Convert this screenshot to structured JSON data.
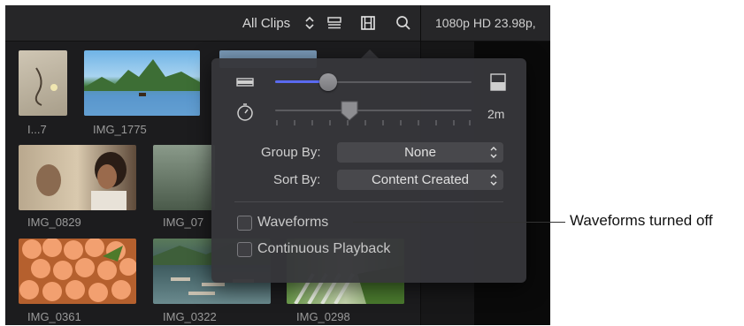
{
  "toolbar": {
    "clips_filter": "All Clips",
    "format_label": "1080p HD 23.98p,",
    "icons": [
      "updown-chevron-icon",
      "list-view-icon",
      "filmstrip-icon",
      "search-icon"
    ]
  },
  "clips": [
    {
      "label": "I...7"
    },
    {
      "label": "IMG_1775"
    },
    {
      "label": "IMG_0829"
    },
    {
      "label": "IMG_07"
    },
    {
      "label": "IMG_0361"
    },
    {
      "label": "IMG_0322"
    },
    {
      "label": "IMG_0298"
    }
  ],
  "popover": {
    "clip_height_slider": {
      "value_fraction": 0.27
    },
    "zoom_slider": {
      "value_label": "2m",
      "value_fraction": 0.38
    },
    "group_by": {
      "label": "Group By:",
      "value": "None"
    },
    "sort_by": {
      "label": "Sort By:",
      "value": "Content Created"
    },
    "waveforms": {
      "label": "Waveforms",
      "checked": false
    },
    "continuous_playback": {
      "label": "Continuous Playback",
      "checked": false
    }
  },
  "callout": {
    "text": "Waveforms turned off"
  },
  "colors": {
    "accent": "#5a6af0",
    "background": "#1c1c1e",
    "popover": "#36363a"
  }
}
